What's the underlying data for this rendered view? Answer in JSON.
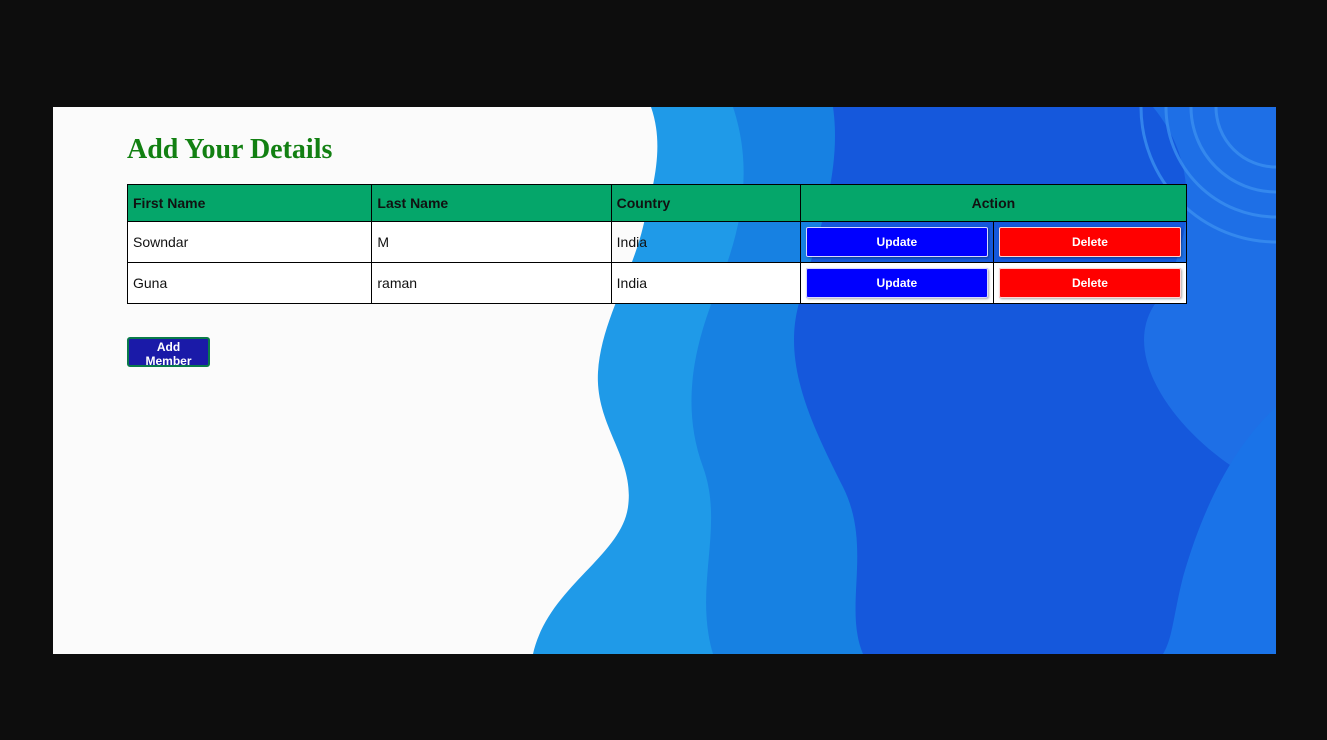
{
  "page": {
    "title": "Add Your Details"
  },
  "table": {
    "headers": {
      "first_name": "First Name",
      "last_name": "Last Name",
      "country": "Country",
      "action": "Action"
    },
    "rows": [
      {
        "first_name": "Sowndar",
        "last_name": "M",
        "country": "India",
        "update_label": "Update",
        "delete_label": "Delete"
      },
      {
        "first_name": "Guna",
        "last_name": "raman",
        "country": "India",
        "update_label": "Update",
        "delete_label": "Delete"
      }
    ]
  },
  "actions": {
    "add_member_label": "Add Member"
  },
  "colors": {
    "title": "#128012",
    "header_bg": "#05a66a",
    "update_bg": "#0000ff",
    "delete_bg": "#ff0000",
    "add_member_bg": "#1a1aa8"
  }
}
